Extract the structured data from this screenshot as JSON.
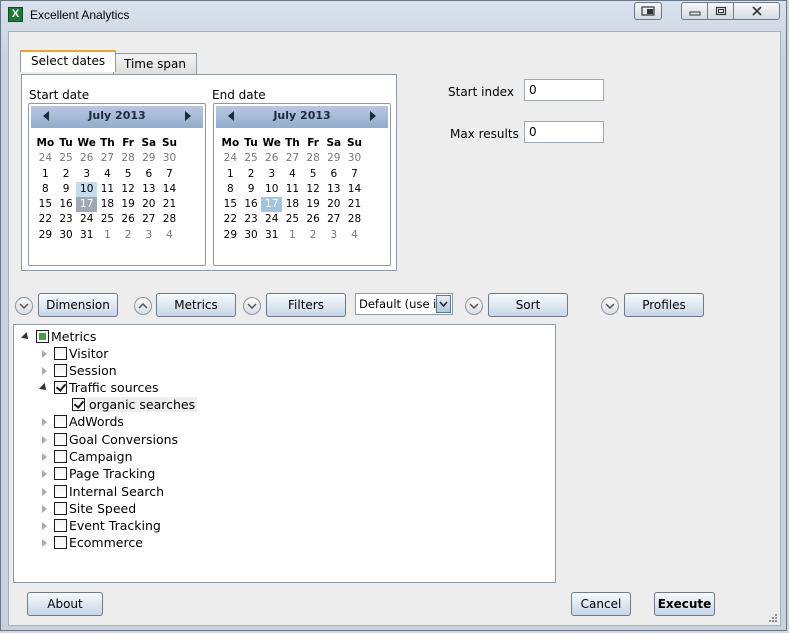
{
  "window": {
    "title": "Excellent Analytics",
    "icon": "excel-icon",
    "buttons": [
      "restore-small-icon",
      "minimize-icon",
      "maximize-icon",
      "close-icon"
    ]
  },
  "tabs": [
    {
      "label": "Select dates",
      "active": true
    },
    {
      "label": "Time span",
      "active": false
    }
  ],
  "start_date": {
    "label": "Start date",
    "month": "July 2013",
    "days_of_week": [
      "Mo",
      "Tu",
      "We",
      "Th",
      "Fr",
      "Sa",
      "Su"
    ],
    "weeks": [
      [
        "24",
        "25",
        "26",
        "27",
        "28",
        "29",
        "30"
      ],
      [
        "1",
        "2",
        "3",
        "4",
        "5",
        "6",
        "7"
      ],
      [
        "8",
        "9",
        "10",
        "11",
        "12",
        "13",
        "14"
      ],
      [
        "15",
        "16",
        "17",
        "18",
        "19",
        "20",
        "21"
      ],
      [
        "22",
        "23",
        "24",
        "25",
        "26",
        "27",
        "28"
      ],
      [
        "29",
        "30",
        "31",
        "1",
        "2",
        "3",
        "4"
      ]
    ],
    "today": "17",
    "selected": "10"
  },
  "end_date": {
    "label": "End date",
    "month": "July 2013",
    "days_of_week": [
      "Mo",
      "Tu",
      "We",
      "Th",
      "Fr",
      "Sa",
      "Su"
    ],
    "weeks": [
      [
        "24",
        "25",
        "26",
        "27",
        "28",
        "29",
        "30"
      ],
      [
        "1",
        "2",
        "3",
        "4",
        "5",
        "6",
        "7"
      ],
      [
        "8",
        "9",
        "10",
        "11",
        "12",
        "13",
        "14"
      ],
      [
        "15",
        "16",
        "17",
        "18",
        "19",
        "20",
        "21"
      ],
      [
        "22",
        "23",
        "24",
        "25",
        "26",
        "27",
        "28"
      ],
      [
        "29",
        "30",
        "31",
        "1",
        "2",
        "3",
        "4"
      ]
    ],
    "selected": "17"
  },
  "start_index": {
    "label": "Start index",
    "value": "0"
  },
  "max_results": {
    "label": "Max results",
    "value": "0"
  },
  "toolbar": {
    "dimension_label": "Dimension",
    "metrics_label": "Metrics",
    "filters_label": "Filters",
    "filter_combo_value": "Default (use if",
    "sort_label": "Sort",
    "profiles_label": "Profiles"
  },
  "tree": {
    "root_label": "Metrics",
    "items": [
      {
        "label": "Visitor",
        "checked": false,
        "expanded": false
      },
      {
        "label": "Session",
        "checked": false,
        "expanded": false
      },
      {
        "label": "Traffic sources",
        "checked": true,
        "expanded": true,
        "children": [
          {
            "label": "organic searches",
            "checked": true
          }
        ]
      },
      {
        "label": "AdWords",
        "checked": false,
        "expanded": false
      },
      {
        "label": "Goal Conversions",
        "checked": false,
        "expanded": false
      },
      {
        "label": "Campaign",
        "checked": false,
        "expanded": false
      },
      {
        "label": "Page Tracking",
        "checked": false,
        "expanded": false
      },
      {
        "label": "Internal Search",
        "checked": false,
        "expanded": false
      },
      {
        "label": "Site Speed",
        "checked": false,
        "expanded": false
      },
      {
        "label": "Event Tracking",
        "checked": false,
        "expanded": false
      },
      {
        "label": "Ecommerce",
        "checked": false,
        "expanded": false
      }
    ]
  },
  "footer": {
    "about_label": "About",
    "cancel_label": "Cancel",
    "execute_label": "Execute"
  }
}
